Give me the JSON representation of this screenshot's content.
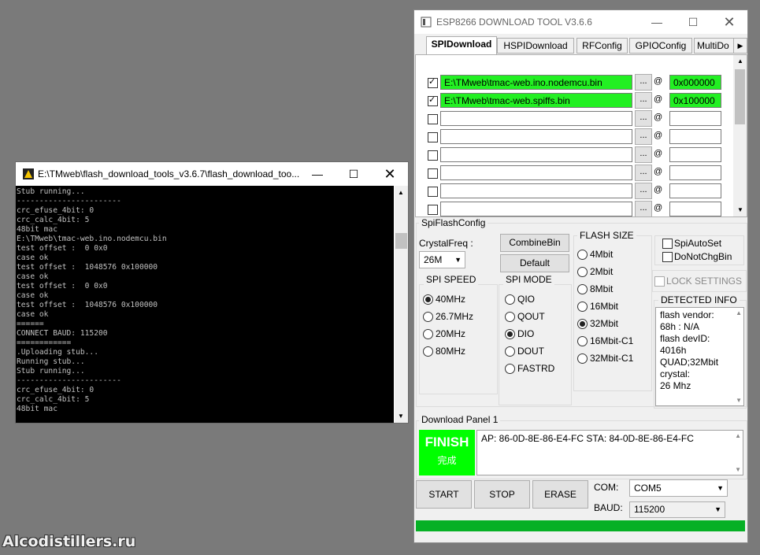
{
  "console": {
    "title": "E:\\TMweb\\flash_download_tools_v3.6.7\\flash_download_too...",
    "lines": "Stub running...\n-----------------------\ncrc_efuse_4bit: 0\ncrc_calc_4bit: 5\n48bit mac\nE:\\TMweb\\tmac-web.ino.nodemcu.bin\ntest offset :  0 0x0\ncase ok\ntest offset :  1048576 0x100000\ncase ok\ntest offset :  0 0x0\ncase ok\ntest offset :  1048576 0x100000\ncase ok\n======\nCONNECT BAUD: 115200\n============\n.Uploading stub...\nRunning stub...\nStub running...\n-----------------------\ncrc_efuse_4bit: 0\ncrc_calc_4bit: 5\n48bit mac"
  },
  "tool": {
    "title": "ESP8266 DOWNLOAD TOOL V3.6.6",
    "tabs": [
      {
        "label": "SPIDownload"
      },
      {
        "label": "HSPIDownload"
      },
      {
        "label": "RFConfig"
      },
      {
        "label": "GPIOConfig"
      },
      {
        "label": "MultiDo"
      }
    ],
    "files": [
      {
        "path": "E:\\TMweb\\tmac-web.ino.nodemcu.bin",
        "addr": "0x000000"
      },
      {
        "path": "E:\\TMweb\\tmac-web.spiffs.bin",
        "addr": "0x100000"
      }
    ],
    "dots_label": "...",
    "at_label": "@",
    "spi_flash_config": "SpiFlashConfig",
    "crystal_label": "CrystalFreq :",
    "crystal_value": "26M",
    "combine_bin": "CombineBin",
    "default_label": "Default",
    "flash_size_label": "FLASH SIZE",
    "flash_sizes": [
      "4Mbit",
      "2Mbit",
      "8Mbit",
      "16Mbit",
      "32Mbit",
      "16Mbit-C1",
      "32Mbit-C1"
    ],
    "spi_auto_set": "SpiAutoSet",
    "do_not_chg_bin": "DoNotChgBin",
    "lock_settings": "LOCK SETTINGS",
    "detected_info_label": "DETECTED INFO",
    "detected_info": [
      "flash vendor:",
      "68h : N/A",
      "flash devID:",
      "4016h",
      "QUAD;32Mbit",
      "crystal:",
      "26 Mhz"
    ],
    "spi_speed_label": "SPI SPEED",
    "spi_speeds": [
      "40MHz",
      "26.7MHz",
      "20MHz",
      "80MHz"
    ],
    "spi_mode_label": "SPI MODE",
    "spi_modes": [
      "QIO",
      "QOUT",
      "DIO",
      "DOUT",
      "FASTRD"
    ],
    "download_panel": "Download Panel 1",
    "finish": "FINISH",
    "finish_cn": "完成",
    "ap_sta": "AP:  86-0D-8E-86-E4-FC  STA:  84-0D-8E-86-E4-FC",
    "start": "START",
    "stop": "STOP",
    "erase": "ERASE",
    "com_label": "COM:",
    "com_value": "COM5",
    "baud_label": "BAUD:",
    "baud_value": "115200"
  },
  "watermark": "Alcodistillers.ru"
}
